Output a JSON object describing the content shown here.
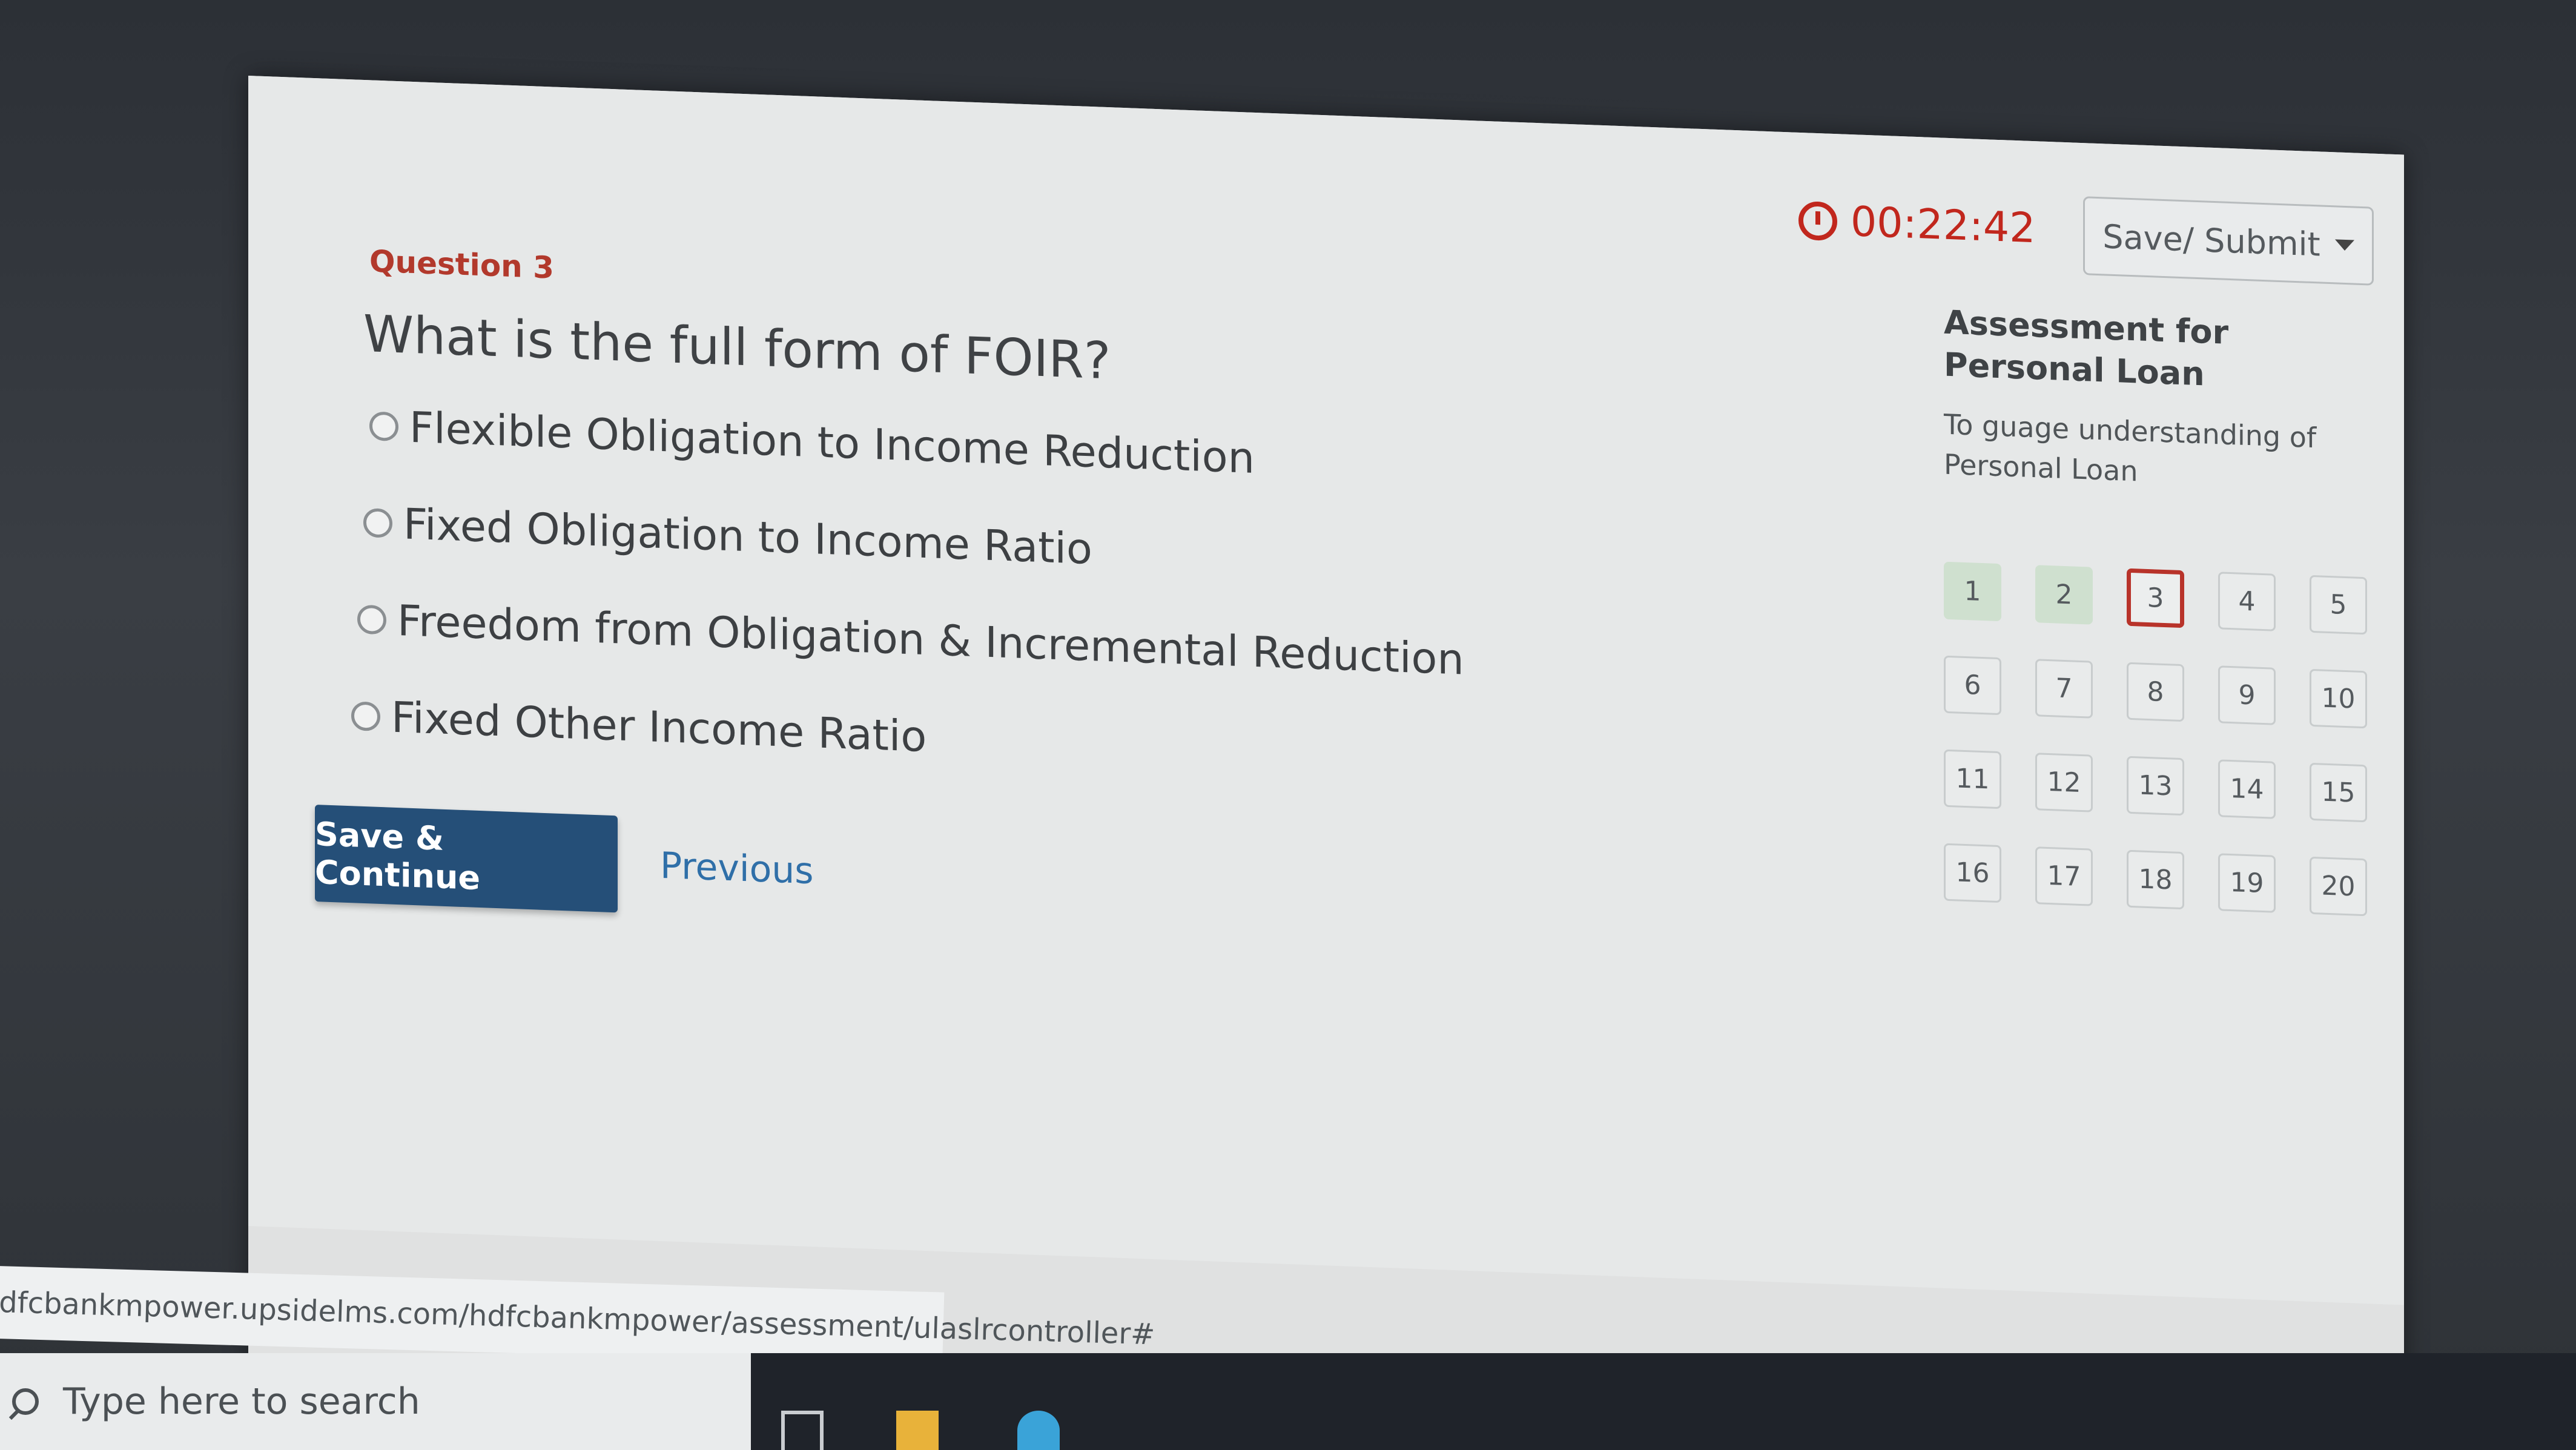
{
  "timer": {
    "value": "00:22:42"
  },
  "toolbar": {
    "save_submit_label": "Save/ Submit"
  },
  "question": {
    "label": "Question 3",
    "text": "What is the full form of FOIR?",
    "options": [
      "Flexible Obligation to Income Reduction",
      "Fixed Obligation to Income Ratio",
      "Freedom from Obligation & Incremental Reduction",
      "Fixed Other Income Ratio"
    ]
  },
  "actions": {
    "save_continue": "Save & Continue",
    "previous": "Previous"
  },
  "sidebar": {
    "title": "Assessment for Personal Loan",
    "description": "To guage understanding of Personal Loan",
    "questions": [
      "1",
      "2",
      "3",
      "4",
      "5",
      "6",
      "7",
      "8",
      "9",
      "10",
      "11",
      "12",
      "13",
      "14",
      "15",
      "16",
      "17",
      "18",
      "19",
      "20"
    ],
    "answered": [
      1,
      2
    ],
    "current": 3
  },
  "browser": {
    "status_url": "dfcbankmpower.upsidelms.com/hdfcbankmpower/assessment/ulaslrcontroller#"
  },
  "taskbar": {
    "search_placeholder": "Type here to search"
  },
  "colors": {
    "accent": "#254f78",
    "timer": "#c1271d",
    "current_question": "#b8332a",
    "answered": "#cfe0cf",
    "link": "#2f6fa8"
  }
}
